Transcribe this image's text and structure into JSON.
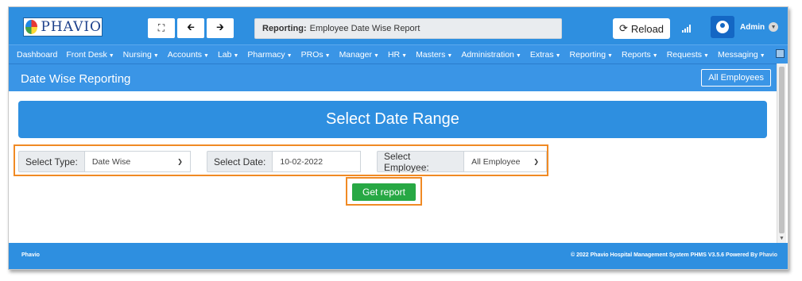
{
  "brand": {
    "logo_text": "PHAVIO"
  },
  "header": {
    "report_label": "Reporting:",
    "report_value": "Employee Date Wise Report",
    "reload_label": "Reload",
    "user_name": "Admin"
  },
  "menu": [
    {
      "label": "Dashboard",
      "caret": false
    },
    {
      "label": "Front Desk",
      "caret": true
    },
    {
      "label": "Nursing",
      "caret": true
    },
    {
      "label": "Accounts",
      "caret": true
    },
    {
      "label": "Lab",
      "caret": true
    },
    {
      "label": "Pharmacy",
      "caret": true
    },
    {
      "label": "PROs",
      "caret": true
    },
    {
      "label": "Manager",
      "caret": true
    },
    {
      "label": "HR",
      "caret": true
    },
    {
      "label": "Masters",
      "caret": true
    },
    {
      "label": "Administration",
      "caret": true
    },
    {
      "label": "Extras",
      "caret": true
    },
    {
      "label": "Reporting",
      "caret": true
    },
    {
      "label": "Reports",
      "caret": true
    },
    {
      "label": "Requests",
      "caret": true
    },
    {
      "label": "Messaging",
      "caret": true
    }
  ],
  "section": {
    "title": "Date Wise Reporting",
    "all_employees_button": "All Employees"
  },
  "range": {
    "title": "Select Date Range"
  },
  "form": {
    "type_label": "Select Type:",
    "type_value": "Date Wise",
    "date_label": "Select Date:",
    "date_value": "10-02-2022",
    "employee_label": "Select Employee:",
    "employee_value": "All Employee",
    "submit_label": "Get report"
  },
  "footer": {
    "left": "Phavio",
    "right": "© 2022 Phavio Hospital Management System PHMS V3.5.6 Powered By",
    "powered_brand": "Phavio"
  },
  "colors": {
    "primary": "#2e8fe0",
    "highlight": "#f08a24",
    "success": "#27a844"
  },
  "icons": {
    "fullscreen": "expand-icon",
    "back": "arrow-left-icon",
    "forward": "arrow-right-icon",
    "reload": "refresh-icon",
    "signal": "signal-icon",
    "user": "user-icon",
    "chevron": "chevron-down-icon"
  }
}
